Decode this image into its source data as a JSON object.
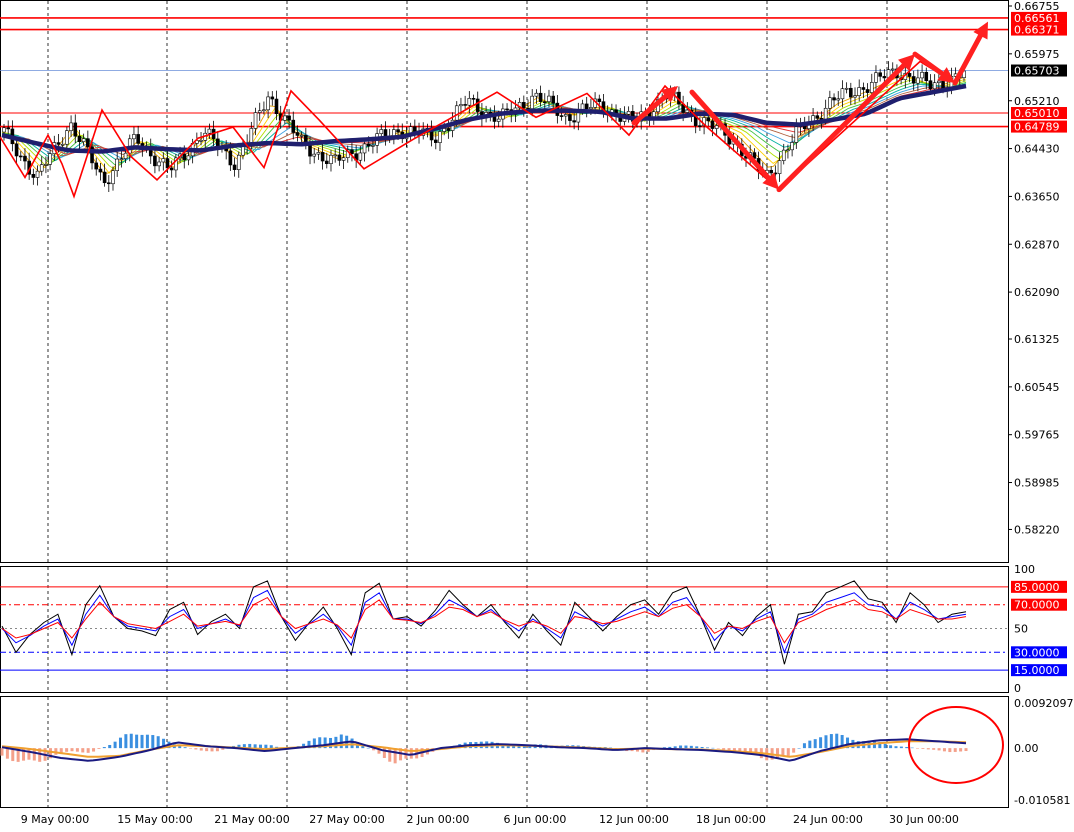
{
  "chart_data": [
    {
      "type": "candlestick",
      "panel": "main",
      "ylim": [
        0.5795,
        0.66755
      ],
      "price_ticks": [
        "0.66755",
        "0.65975",
        "0.65210",
        "0.64430",
        "0.63650",
        "0.62870",
        "0.62090",
        "0.61325",
        "0.60545",
        "0.59765",
        "0.58985",
        "0.58220"
      ],
      "levels": [
        {
          "label": "0.66561",
          "value": 0.66561,
          "color": "#ff0000"
        },
        {
          "label": "0.66371",
          "value": 0.66371,
          "color": "#ff0000"
        },
        {
          "label": "0.65010",
          "value": 0.6501,
          "color": "#ff0000"
        },
        {
          "label": "0.64789",
          "value": 0.64789,
          "color": "#ff0000"
        }
      ],
      "current_price": {
        "label": "0.65703",
        "value": 0.65703,
        "color": "#000000"
      },
      "x_ticks": [
        "9 May 00:00",
        "15 May 00:00",
        "21 May 00:00",
        "27 May 00:00",
        "2 Jun 00:00",
        "6 Jun 00:00",
        "12 Jun 00:00",
        "18 Jun 00:00",
        "24 Jun 00:00",
        "30 Jun 00:00"
      ],
      "ma_line": [
        0.6465,
        0.6452,
        0.644,
        0.6438,
        0.6445,
        0.6442,
        0.644,
        0.6448,
        0.6452,
        0.645,
        0.6455,
        0.6458,
        0.6462,
        0.6475,
        0.649,
        0.65,
        0.6505,
        0.6505,
        0.6503,
        0.6492,
        0.6492,
        0.65,
        0.6498,
        0.6485,
        0.6482,
        0.649,
        0.65,
        0.6525,
        0.6535,
        0.6545
      ],
      "price_path": [
        0.647,
        0.6395,
        0.6485,
        0.639,
        0.646,
        0.6405,
        0.647,
        0.642,
        0.653,
        0.645,
        0.642,
        0.645,
        0.6475,
        0.646,
        0.652,
        0.649,
        0.653,
        0.6495,
        0.6515,
        0.6485,
        0.653,
        0.649,
        0.646,
        0.6395,
        0.647,
        0.652,
        0.6545,
        0.657,
        0.6545,
        0.6565
      ],
      "zigzag": [
        [
          0,
          0.6462
        ],
        [
          25,
          0.6396
        ],
        [
          48,
          0.6465
        ],
        [
          62,
          0.6418
        ],
        [
          74,
          0.6365
        ],
        [
          102,
          0.6506
        ],
        [
          131,
          0.643
        ],
        [
          157,
          0.6392
        ],
        [
          198,
          0.646
        ],
        [
          233,
          0.6478
        ],
        [
          264,
          0.6412
        ],
        [
          291,
          0.6537
        ],
        [
          319,
          0.649
        ],
        [
          364,
          0.641
        ],
        [
          413,
          0.6458
        ],
        [
          497,
          0.6535
        ],
        [
          536,
          0.6494
        ],
        [
          587,
          0.6533
        ],
        [
          629,
          0.6465
        ],
        [
          665,
          0.6545
        ],
        [
          707,
          0.6478
        ],
        [
          779,
          0.6376
        ],
        [
          920,
          0.6585
        ],
        [
          955,
          0.655
        ]
      ],
      "arrows": [
        [
          634,
          0.6485,
          678,
          0.6545
        ],
        [
          692,
          0.6535,
          779,
          0.6376
        ],
        [
          779,
          0.6376,
          915,
          0.6597
        ],
        [
          915,
          0.6597,
          955,
          0.655
        ],
        [
          955,
          0.655,
          988,
          0.665
        ]
      ],
      "ribbon_colors": [
        "#e6a000",
        "#ffd000",
        "#b0e000",
        "#40c040",
        "#00b0a0",
        "#40a0e0",
        "#b06040",
        "#e03030"
      ]
    },
    {
      "type": "line",
      "panel": "oscillator",
      "ylim": [
        0,
        100
      ],
      "y_ticks": [
        "100",
        "50",
        "0"
      ],
      "levels": [
        {
          "label": "85.0000",
          "value": 85,
          "color": "#ff0000"
        },
        {
          "label": "70.0000",
          "value": 70,
          "color": "#ff0000"
        },
        {
          "label": "30.0000",
          "value": 30,
          "color": "#0000ff"
        },
        {
          "label": "15.0000",
          "value": 15,
          "color": "#0000ff"
        }
      ],
      "midline": 50,
      "series": [
        {
          "color": "#000000",
          "values": [
            52,
            30,
            45,
            55,
            62,
            28,
            70,
            86,
            60,
            50,
            48,
            44,
            66,
            72,
            45,
            56,
            62,
            50,
            85,
            90,
            60,
            40,
            55,
            68,
            50,
            28,
            80,
            88,
            58,
            60,
            52,
            65,
            82,
            70,
            60,
            70,
            55,
            42,
            62,
            48,
            36,
            72,
            60,
            48,
            60,
            70,
            74,
            62,
            80,
            85,
            60,
            32,
            55,
            44,
            60,
            70,
            20,
            62,
            64,
            80,
            85,
            90,
            75,
            72,
            55,
            80,
            70,
            55,
            62,
            64
          ]
        },
        {
          "color": "#0000ff",
          "values": [
            50,
            38,
            44,
            52,
            58,
            36,
            62,
            78,
            60,
            52,
            50,
            48,
            60,
            66,
            50,
            54,
            58,
            52,
            76,
            82,
            60,
            46,
            54,
            62,
            52,
            36,
            72,
            80,
            58,
            58,
            54,
            62,
            74,
            68,
            60,
            66,
            56,
            48,
            58,
            50,
            42,
            64,
            58,
            52,
            58,
            64,
            68,
            60,
            72,
            76,
            60,
            40,
            52,
            48,
            58,
            64,
            30,
            58,
            62,
            72,
            76,
            80,
            70,
            68,
            58,
            72,
            66,
            58,
            60,
            62
          ]
        },
        {
          "color": "#ff0000",
          "values": [
            50,
            42,
            45,
            50,
            55,
            42,
            58,
            72,
            60,
            54,
            52,
            50,
            56,
            62,
            52,
            54,
            56,
            53,
            70,
            76,
            60,
            50,
            54,
            58,
            53,
            42,
            66,
            74,
            58,
            57,
            55,
            60,
            68,
            66,
            60,
            64,
            57,
            52,
            56,
            52,
            46,
            60,
            58,
            54,
            56,
            60,
            64,
            60,
            67,
            70,
            60,
            46,
            52,
            50,
            56,
            60,
            38,
            55,
            60,
            66,
            70,
            74,
            66,
            64,
            58,
            66,
            62,
            58,
            58,
            60
          ]
        }
      ]
    },
    {
      "type": "histogram",
      "panel": "macd",
      "ylim": [
        -0.010581,
        0.0092097
      ],
      "y_ticks": [
        "0.0092097",
        "0.00",
        "-0.010581"
      ],
      "histogram": [
        -0.0018,
        -0.0032,
        -0.0035,
        -0.0015,
        -0.0008,
        -0.001,
        0.0008,
        0.003,
        0.004,
        0.002,
        0.0005,
        -0.0004,
        -0.001,
        0.0005,
        0.0012,
        0.0007,
        -0.0004,
        0.0012,
        0.0028,
        0.0032,
        0.0012,
        -0.001,
        -0.0035,
        -0.0028,
        -0.001,
        0.0002,
        0.0012,
        0.002,
        0.0008,
        0.0006,
        0.0008,
        0.0007,
        0.0006,
        0.0004,
        0.0002,
        -0.0008,
        -0.001,
        0.0002,
        0.0006,
        0.0004,
        0,
        -0.0008,
        -0.0012,
        -0.0028,
        -0.0022,
        0.0012,
        0.0035,
        0.0028,
        0.002,
        0.0014,
        0.0006,
        0.0001,
        -0.0004,
        -0.0008,
        -0.0008
      ],
      "macd_line": [
        0.0002,
        -0.0008,
        -0.002,
        -0.0026,
        -0.0018,
        -0.0005,
        0.0012,
        0.0004,
        0.0,
        -0.0006,
        0.0,
        0.0006,
        0.0014,
        -0.0004,
        -0.0014,
        0.0,
        0.0006,
        0.0008,
        0.0006,
        0.0002,
        0.0,
        -0.0004,
        0.0,
        -0.0002,
        -0.0004,
        -0.0008,
        -0.0014,
        -0.0026,
        -0.0006,
        0.0008,
        0.0016,
        0.0018,
        0.0014,
        0.001
      ],
      "signal_line": [
        0.0004,
        -0.0002,
        -0.001,
        -0.0018,
        -0.0016,
        -0.0004,
        0.0006,
        0.0004,
        0.0001,
        -0.0002,
        0.0001,
        0.0004,
        0.0008,
        0.0002,
        -0.0006,
        -0.0002,
        0.0004,
        0.0006,
        0.0005,
        0.0003,
        0.0001,
        -0.0002,
        -0.0001,
        -0.0002,
        -0.0003,
        -0.0006,
        -0.001,
        -0.0018,
        -0.0008,
        0.0004,
        0.001,
        0.0014,
        0.0014,
        0.0012
      ]
    }
  ]
}
